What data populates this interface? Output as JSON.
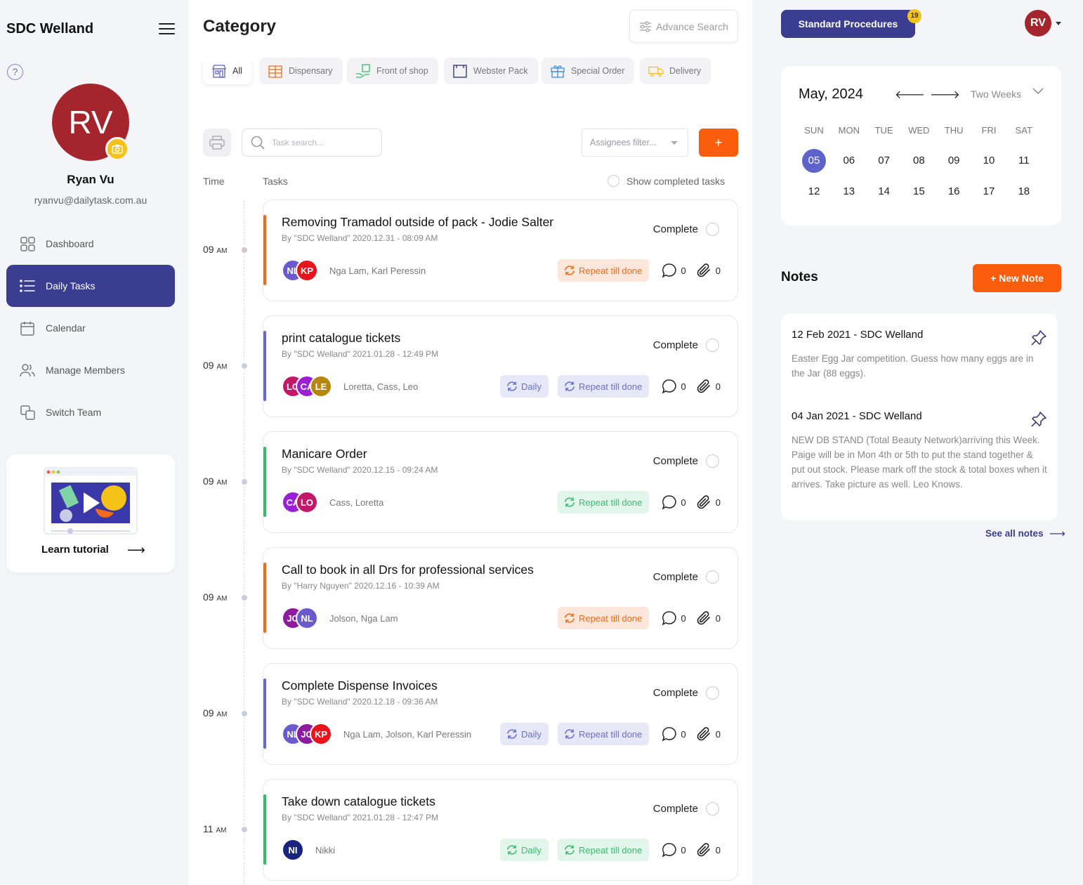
{
  "sidebar": {
    "brand": "SDC Welland",
    "help_icon": "?",
    "user": {
      "initials": "RV",
      "name": "Ryan Vu",
      "email": "ryanvu@dailytask.com.au"
    },
    "nav": [
      {
        "label": "Dashboard",
        "icon": "grid-icon"
      },
      {
        "label": "Daily Tasks",
        "icon": "list-icon",
        "active": true
      },
      {
        "label": "Calendar",
        "icon": "calendar-icon"
      },
      {
        "label": "Manage Members",
        "icon": "users-icon"
      },
      {
        "label": "Switch Team",
        "icon": "switch-icon"
      }
    ],
    "tutorial": {
      "label": "Learn tutorial",
      "arrow": "⟶"
    }
  },
  "main": {
    "title": "Category",
    "advance_search": "Advance Search",
    "categories": [
      {
        "label": "All",
        "active": true
      },
      {
        "label": "Dispensary"
      },
      {
        "label": "Front of shop"
      },
      {
        "label": "Webster Pack"
      },
      {
        "label": "Special Order"
      },
      {
        "label": "Delivery"
      }
    ],
    "search_placeholder": "Task search...",
    "assignee_filter": "Assignees filter...",
    "add_label": "+",
    "col_time": "Time",
    "col_tasks": "Tasks",
    "show_completed": "Show completed tasks",
    "complete_label": "Complete",
    "tasks": [
      {
        "time": "09",
        "ampm": "AM",
        "title": "Removing Tramadol outside of pack - Jodie Salter",
        "meta": "By \"SDC Welland\" 2020.12.31 - 08:09 AM",
        "accent": "#f46a1b",
        "avatars": [
          {
            "initials": "NL",
            "color": "#6a5acd"
          },
          {
            "initials": "KP",
            "color": "#e8141b"
          }
        ],
        "assignees": "Nga Lam, Karl Peressin",
        "daily": false,
        "repeat": "Repeat till done",
        "repeat_color": "orange",
        "comments": "0",
        "attachments": "0"
      },
      {
        "time": "09",
        "ampm": "AM",
        "title": "print catalogue tickets",
        "meta": "By \"SDC Welland\" 2021.01.28 - 12:49 PM",
        "accent": "#6468d4",
        "avatars": [
          {
            "initials": "LO",
            "color": "#c2186a"
          },
          {
            "initials": "CA",
            "color": "#9b1fd4"
          },
          {
            "initials": "LE",
            "color": "#b8860b"
          }
        ],
        "assignees": "Loretta, Cass, Leo",
        "daily": "Daily",
        "daily_color": "purple",
        "repeat": "Repeat till done",
        "repeat_color": "purple",
        "comments": "0",
        "attachments": "0"
      },
      {
        "time": "09",
        "ampm": "AM",
        "title": "Manicare Order",
        "meta": "By \"SDC Welland\" 2020.12.15 - 09:24 AM",
        "accent": "#35bb6a",
        "avatars": [
          {
            "initials": "CA",
            "color": "#9b1fd4"
          },
          {
            "initials": "LO",
            "color": "#c2186a"
          }
        ],
        "assignees": "Cass, Loretta",
        "daily": false,
        "repeat": "Repeat till done",
        "repeat_color": "green",
        "comments": "0",
        "attachments": "0"
      },
      {
        "time": "09",
        "ampm": "AM",
        "title": "Call to book in all Drs for professional services",
        "meta": "By \"Harry Nguyen\" 2020.12.16 - 10:39 AM",
        "accent": "#f46a1b",
        "avatars": [
          {
            "initials": "JO",
            "color": "#8e1a9e"
          },
          {
            "initials": "NL",
            "color": "#6a5acd"
          }
        ],
        "assignees": "Jolson, Nga Lam",
        "daily": false,
        "repeat": "Repeat till done",
        "repeat_color": "orange",
        "comments": "0",
        "attachments": "0"
      },
      {
        "time": "09",
        "ampm": "AM",
        "title": "Complete Dispense Invoices",
        "meta": "By \"SDC Welland\" 2020.12.18 - 09:36 AM",
        "accent": "#6468d4",
        "avatars": [
          {
            "initials": "NL",
            "color": "#6a5acd"
          },
          {
            "initials": "JO",
            "color": "#8e1a9e"
          },
          {
            "initials": "KP",
            "color": "#e8141b"
          }
        ],
        "assignees": "Nga Lam, Jolson, Karl Peressin",
        "daily": "Daily",
        "daily_color": "purple",
        "repeat": "Repeat till done",
        "repeat_color": "purple",
        "comments": "0",
        "attachments": "0"
      },
      {
        "time": "11",
        "ampm": "AM",
        "title": "Take down catalogue tickets",
        "meta": "By \"SDC Welland\" 2021.01.28 - 12:47 PM",
        "accent": "#35bb6a",
        "avatars": [
          {
            "initials": "NI",
            "color": "#1a237e"
          }
        ],
        "assignees": "Nikki",
        "daily": "Daily",
        "daily_color": "green",
        "repeat": "Repeat till done",
        "repeat_color": "green",
        "comments": "0",
        "attachments": "0"
      }
    ]
  },
  "right": {
    "standard_procedures": "Standard Procedures",
    "procedures_badge": "19",
    "user_initials": "RV",
    "calendar": {
      "month": "May, 2024",
      "prev": "🡐",
      "next": "🡒",
      "range": "Two Weeks",
      "dow": [
        "SUN",
        "MON",
        "TUE",
        "WED",
        "THU",
        "FRI",
        "SAT"
      ],
      "weeks": [
        [
          "05",
          "06",
          "07",
          "08",
          "09",
          "10",
          "11"
        ],
        [
          "12",
          "13",
          "14",
          "15",
          "16",
          "17",
          "18"
        ]
      ],
      "selected": "05"
    },
    "notes_title": "Notes",
    "new_note": "+ New Note",
    "notes": [
      {
        "head": "12 Feb 2021 - SDC Welland",
        "body": "Easter Egg Jar competition. Guess how many eggs are in the Jar (88 eggs)."
      },
      {
        "head": "04 Jan 2021 - SDC Welland",
        "body": "NEW DB STAND (Total Beauty Network)arriving this Week. Paige will be in Mon 4th or 5th to put the stand together & put out stock. Please mark off the stock & total boxes when it arrives. Take picture as well. Leo Knows."
      }
    ],
    "see_all": "See all notes",
    "see_all_arrow": "⟶"
  }
}
